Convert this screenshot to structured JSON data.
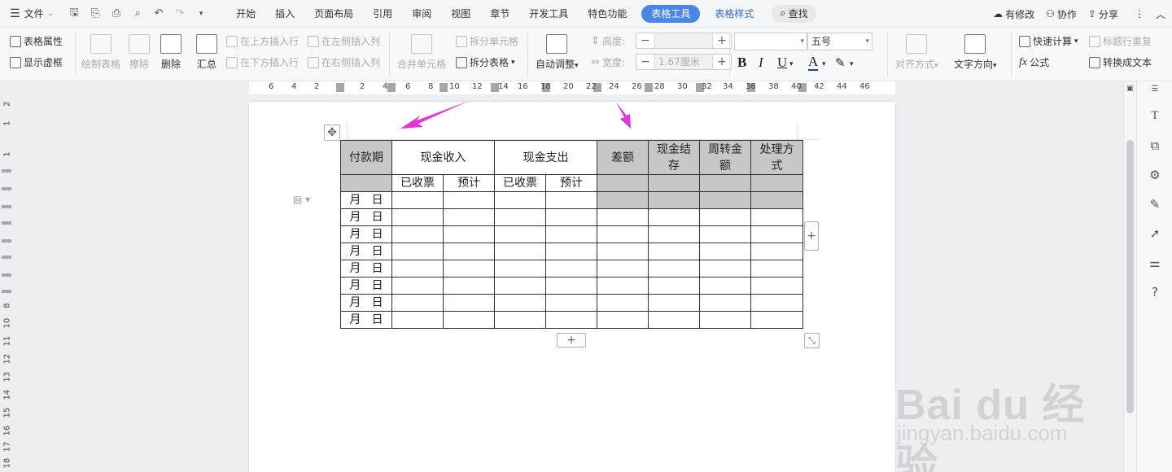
{
  "menubar": {
    "file_label": "文件",
    "tabs": [
      "开始",
      "插入",
      "页面布局",
      "引用",
      "审阅",
      "视图",
      "章节",
      "开发工具",
      "特色功能"
    ],
    "active_tab": "表格工具",
    "style_tab": "表格样式",
    "search_label": "查找",
    "right": {
      "changes": "有修改",
      "collab": "协作",
      "share": "分享"
    }
  },
  "ribbon": {
    "table_props": "表格属性",
    "show_grid": "显示虚框",
    "draw_table": "绘制表格",
    "erase": "擦除",
    "delete": "删除",
    "summary": "汇总",
    "insert_above": "在上方插入行",
    "insert_below": "在下方插入行",
    "insert_left": "在左侧插入列",
    "insert_right": "在右侧插入列",
    "merge_cells": "合并单元格",
    "split_cells": "拆分单元格",
    "split_table": "拆分表格",
    "auto_fit": "自动调整",
    "height_label": "高度:",
    "width_label": "宽度:",
    "width_value": "1.67厘米",
    "font_size": "五号",
    "align": "对齐方式",
    "text_dir": "文字方向",
    "quick_calc": "快速计算",
    "repeat_header": "标题行重复",
    "formula": "公式",
    "to_text": "转换成文本"
  },
  "hruler": {
    "labels": [
      "6",
      "4",
      "2",
      "2",
      "4",
      "6",
      "8",
      "10",
      "12",
      "14",
      "16",
      "18",
      "20",
      "22",
      "24",
      "26",
      "28",
      "30",
      "32",
      "34",
      "36",
      "38",
      "40",
      "42",
      "44",
      "46"
    ]
  },
  "vruler": {
    "labels": [
      "2",
      "1",
      "1",
      "8",
      "9",
      "10",
      "11",
      "12",
      "13",
      "14",
      "15",
      "16",
      "17",
      "18",
      "19"
    ]
  },
  "table": {
    "header1": [
      "付款期",
      "现金收入",
      "现金支出",
      "差额",
      "现金结存",
      "周转金额",
      "处理方式"
    ],
    "header2": [
      "已收票",
      "预计",
      "已收票",
      "预计"
    ],
    "row_label": "月   日",
    "row_count": 8
  },
  "watermark": {
    "logo": "Bai du 经验",
    "sub": "jingyan.baidu.com"
  },
  "colors": {
    "accent": "#4a86e8",
    "arrow": "#e535d8",
    "header_gray": "#c7c7c7"
  }
}
